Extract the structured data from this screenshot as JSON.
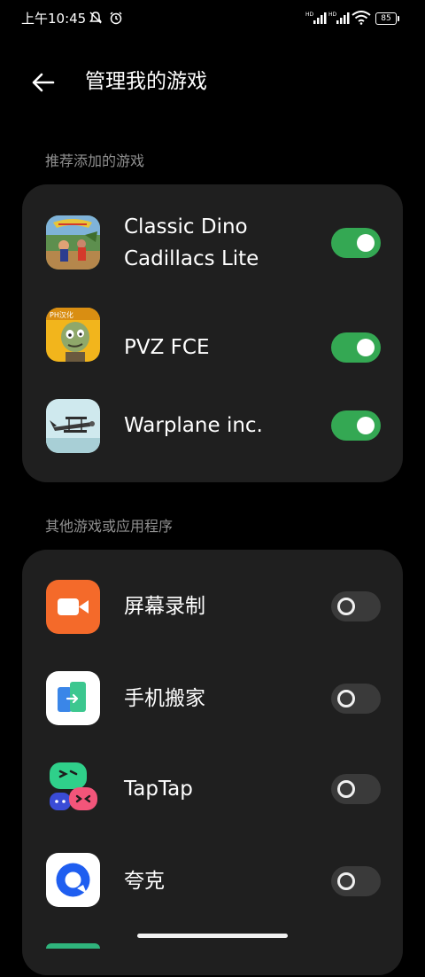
{
  "status_bar": {
    "time": "上午10:45",
    "battery": "85",
    "icons": [
      "mute-notification-icon",
      "alarm-icon",
      "hd-signal-icon",
      "hd-signal-icon",
      "wifi-icon",
      "battery-icon"
    ]
  },
  "header": {
    "back_icon": "arrow-left-icon",
    "title": "管理我的游戏"
  },
  "recommended": {
    "label": "推荐添加的游戏",
    "apps": [
      {
        "name": "Classic Dino Cadillacs Lite",
        "line1": "Classic Dino",
        "line2": "Cadillacs Lite",
        "enabled": true,
        "icon": "dino-game-icon"
      },
      {
        "name": "PVZ FCE",
        "enabled": true,
        "icon": "zombie-game-icon"
      },
      {
        "name": "Warplane inc.",
        "enabled": true,
        "icon": "warplane-game-icon"
      }
    ]
  },
  "others": {
    "label": "其他游戏或应用程序",
    "apps": [
      {
        "name": "屏幕录制",
        "enabled": false,
        "icon": "screen-recorder-icon"
      },
      {
        "name": "手机搬家",
        "enabled": false,
        "icon": "phone-transfer-icon"
      },
      {
        "name": "TapTap",
        "enabled": false,
        "icon": "taptap-icon"
      },
      {
        "name": "夸克",
        "enabled": false,
        "icon": "quark-browser-icon"
      }
    ]
  },
  "colors": {
    "background": "#000000",
    "card": "#1f1f1f",
    "toggle_on": "#34a853",
    "toggle_off": "#3a3a3a",
    "section_label": "#8f8f8f"
  }
}
